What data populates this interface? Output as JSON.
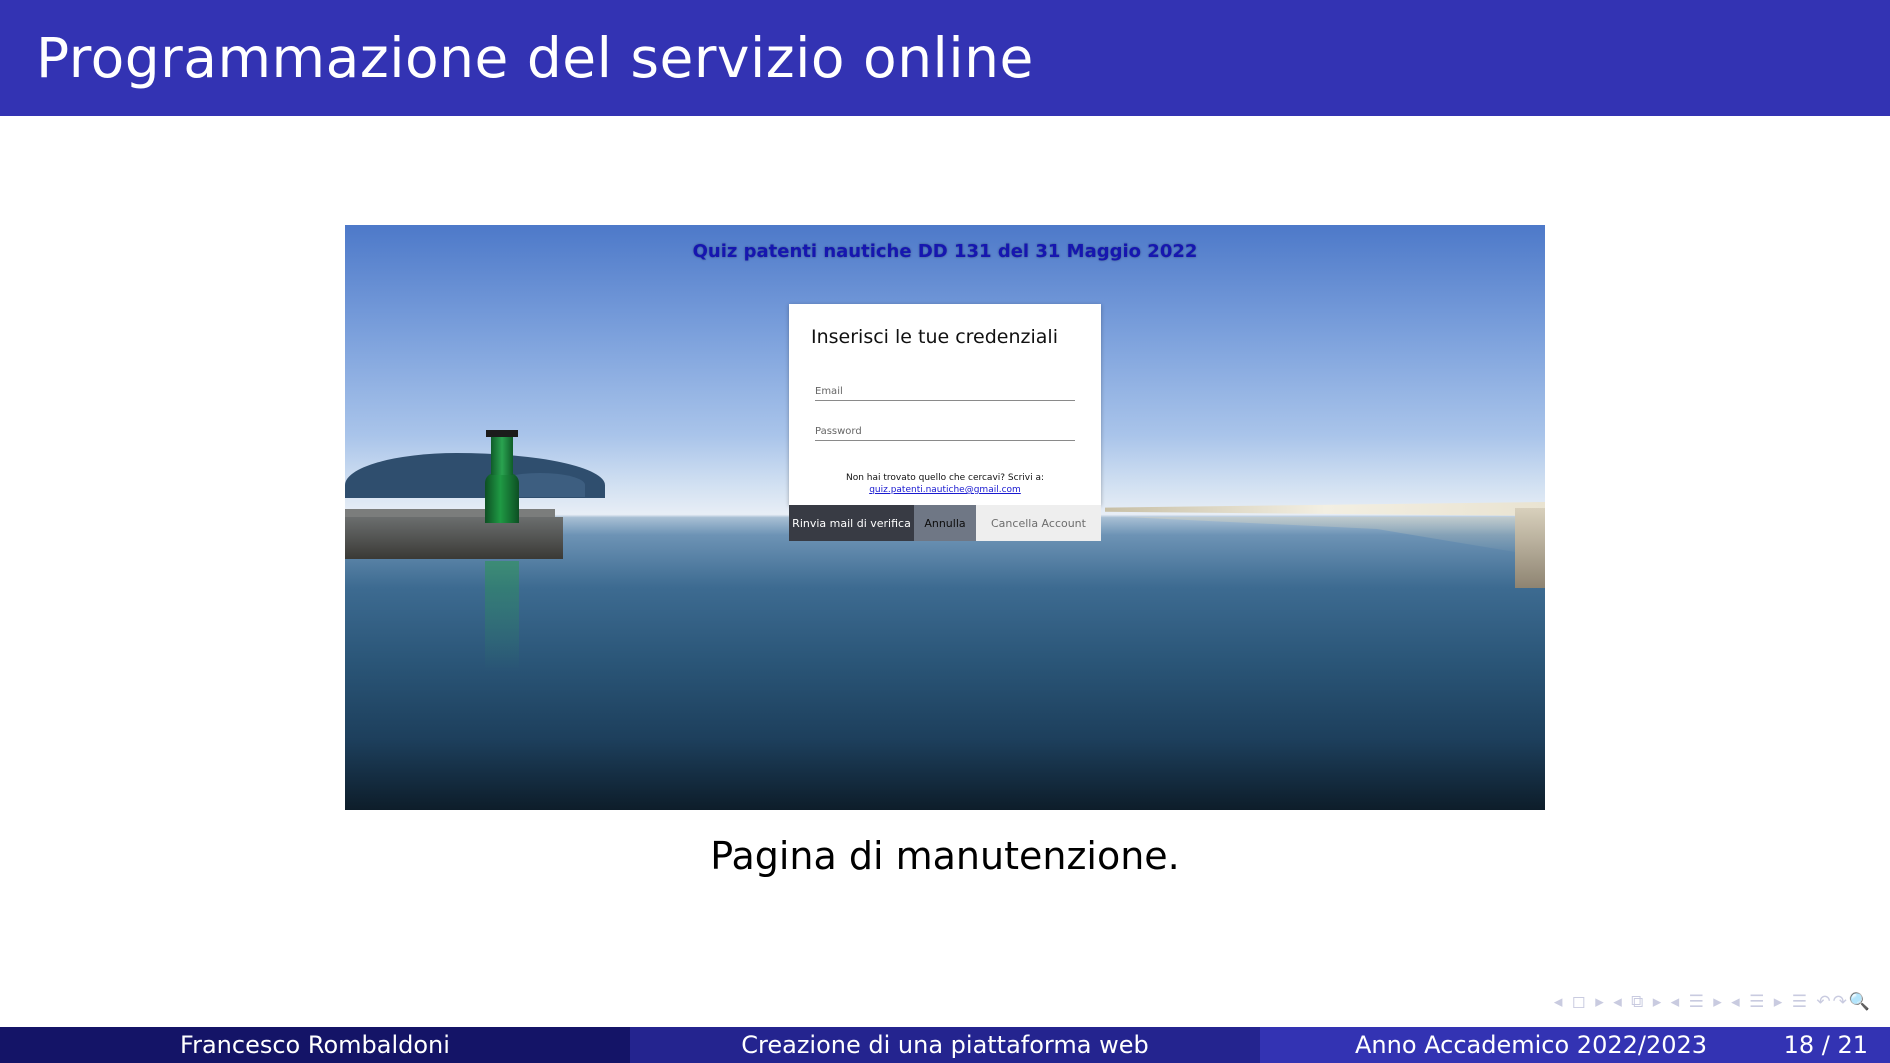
{
  "slide": {
    "title": "Programmazione del servizio online",
    "caption": "Pagina di manutenzione."
  },
  "screenshot": {
    "page_title": "Quiz patenti nautiche DD 131 del 31 Maggio 2022",
    "login_card": {
      "heading": "Inserisci le tue credenziali",
      "email_placeholder": "Email",
      "password_placeholder": "Password",
      "help_text": "Non hai trovato quello che cercavi? Scrivi a:",
      "help_email": "quiz.patenti.nautiche@gmail.com",
      "buttons": {
        "resend": "Rinvia mail di verifica",
        "cancel": "Annulla",
        "delete": "Cancella Account"
      }
    }
  },
  "nav": {
    "symbols": "◂ ◻ ▸ ◂ ⧉ ▸ ◂ ☰ ▸ ◂ ☰ ▸ ☰ ↶↷🔍"
  },
  "footer": {
    "author": "Francesco Rombaldoni",
    "presentation_title": "Creazione di una piattaforma web",
    "academic_year": "Anno Accademico 2022/2023",
    "page_number": "18 / 21"
  },
  "colors": {
    "header_bg": "#3333b3",
    "footer_left": "#141467",
    "footer_center": "#24248f",
    "footer_right": "#3333b3"
  }
}
